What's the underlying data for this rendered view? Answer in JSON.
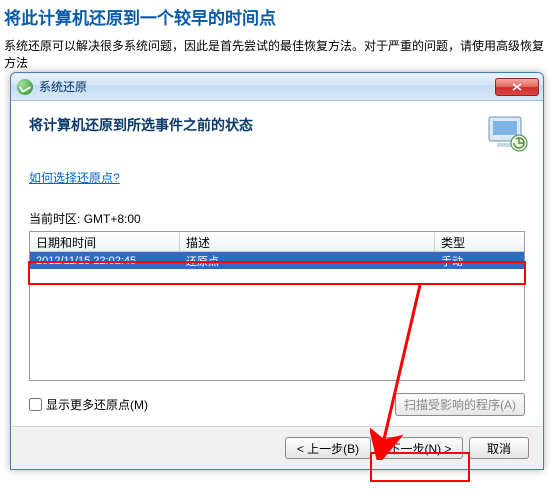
{
  "page": {
    "title": "将此计算机还原到一个较早的时间点",
    "description": "系统还原可以解决很多系统问题，因此是首先尝试的最佳恢复方法。对于严重的问题，请使用高级恢复方法"
  },
  "dialog": {
    "title": "系统还原",
    "heading": "将计算机还原到所选事件之前的状态",
    "help_link": "如何选择还原点?",
    "timezone_label": "当前时区:",
    "timezone_value": "GMT+8:00",
    "columns": {
      "date": "日期和时间",
      "desc": "描述",
      "type": "类型"
    },
    "rows": [
      {
        "date": "2012/11/15 22:02:45",
        "desc": "还原点",
        "type": "手动"
      }
    ],
    "show_more_label": "显示更多还原点(M)",
    "scan_button": "扫描受影响的程序(A)",
    "buttons": {
      "back": "< 上一步(B)",
      "next": "下一步(N) >",
      "cancel": "取消"
    }
  },
  "annotations": {
    "row_box": true,
    "next_box": true,
    "arrow": true
  }
}
